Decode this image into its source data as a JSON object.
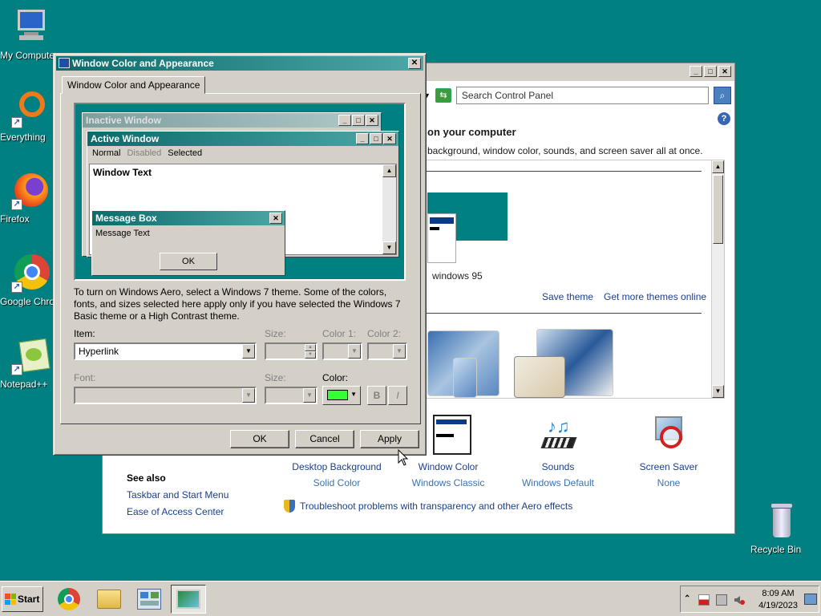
{
  "desktop": {
    "icons": [
      {
        "label": "My Computer"
      },
      {
        "label": "Everything"
      },
      {
        "label": "Firefox"
      },
      {
        "label": "Google Chrome"
      },
      {
        "label": "Notepad++"
      },
      {
        "label": "Recycle Bin"
      }
    ]
  },
  "control_panel": {
    "search_placeholder": "Search Control Panel",
    "heading": "on your computer",
    "subtitle": "background, window color, sounds, and screen saver all at once.",
    "theme_name": "windows 95",
    "save_theme": "Save theme",
    "more_themes": "Get more themes online",
    "bottom_items": [
      {
        "title": "Desktop Background",
        "value": "Solid Color"
      },
      {
        "title": "Window Color",
        "value": "Windows Classic"
      },
      {
        "title": "Sounds",
        "value": "Windows Default"
      },
      {
        "title": "Screen Saver",
        "value": "None"
      }
    ],
    "see_also": "See also",
    "see_also_links": [
      "Taskbar and Start Menu",
      "Ease of Access Center"
    ],
    "troubleshoot": "Troubleshoot problems with transparency and other Aero effects"
  },
  "dialog": {
    "title": "Window Color and Appearance",
    "tab": "Window Color and Appearance",
    "preview": {
      "inactive_title": "Inactive Window",
      "active_title": "Active Window",
      "menu_normal": "Normal",
      "menu_disabled": "Disabled",
      "menu_selected": "Selected",
      "window_text": "Window Text",
      "msgbox_title": "Message Box",
      "msgbox_text": "Message Text",
      "msgbox_ok": "OK"
    },
    "info": "To turn on Windows Aero, select a Windows 7 theme.  Some of the colors, fonts, and sizes selected here apply only if you have selected the Windows 7 Basic theme or a High Contrast theme.",
    "item_label": "Item:",
    "item_value": "Hyperlink",
    "size_label": "Size:",
    "color1_label": "Color 1:",
    "color2_label": "Color 2:",
    "font_label": "Font:",
    "font_size_label": "Size:",
    "color_label": "Color:",
    "selected_color": "#33ff33",
    "bold_label": "B",
    "italic_label": "I",
    "ok": "OK",
    "cancel": "Cancel",
    "apply": "Apply"
  },
  "taskbar": {
    "start": "Start",
    "time": "8:09 AM",
    "date": "4/19/2023"
  }
}
